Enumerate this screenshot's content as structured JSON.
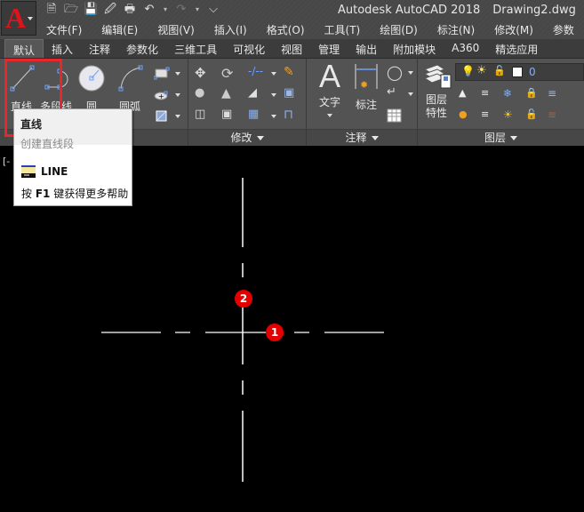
{
  "app": {
    "title": "Autodesk AutoCAD 2018",
    "document": "Drawing2.dwg",
    "logo_letter": "A"
  },
  "quick_access": [
    {
      "icon": "new-file-icon"
    },
    {
      "icon": "open-folder-icon"
    },
    {
      "icon": "save-icon"
    },
    {
      "icon": "save-as-icon"
    },
    {
      "icon": "print-icon"
    },
    {
      "icon": "undo-icon"
    },
    {
      "icon": "redo-icon"
    },
    {
      "icon": "customize-toolbar-icon"
    }
  ],
  "menu": [
    "文件(F)",
    "编辑(E)",
    "视图(V)",
    "插入(I)",
    "格式(O)",
    "工具(T)",
    "绘图(D)",
    "标注(N)",
    "修改(M)",
    "参数"
  ],
  "tabs": [
    {
      "label": "默认",
      "active": true
    },
    {
      "label": "插入"
    },
    {
      "label": "注释"
    },
    {
      "label": "参数化"
    },
    {
      "label": "三维工具"
    },
    {
      "label": "可视化"
    },
    {
      "label": "视图"
    },
    {
      "label": "管理"
    },
    {
      "label": "输出"
    },
    {
      "label": "附加模块"
    },
    {
      "label": "A360"
    },
    {
      "label": "精选应用"
    }
  ],
  "ribbon": {
    "draw": {
      "line": "直线",
      "polyline": "多段线",
      "circle": "圆",
      "arc": "圆弧"
    },
    "modify": {
      "footer": "修改"
    },
    "annotation": {
      "text": "文字",
      "dimension": "标注",
      "footer": "注释"
    },
    "layers": {
      "properties_line1": "图层",
      "properties_line2": "特性",
      "current_layer": "0",
      "footer": "图层"
    }
  },
  "tooltip": {
    "title": "直线",
    "description": "创建直线段",
    "command": "LINE",
    "help_prefix": "按",
    "help_key": "F1",
    "help_suffix": "键获得更多帮助"
  },
  "canvas": {
    "viewport_label": "[-",
    "markers": [
      "1",
      "2"
    ]
  },
  "colors": {
    "highlight": "#e8262b",
    "marker": "#e50000",
    "canvas_bg": "#000000"
  }
}
